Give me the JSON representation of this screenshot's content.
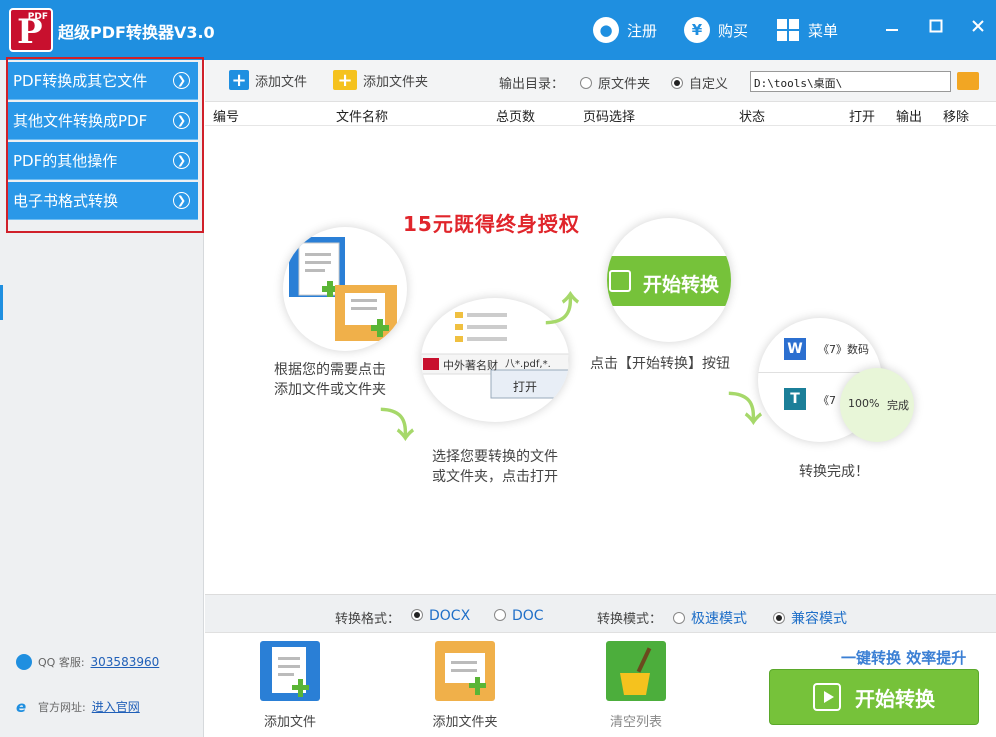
{
  "app": {
    "title": "超级PDF转换器V3.0",
    "logo_tag": "PDF",
    "logo_letter": "P"
  },
  "titlebar": {
    "register": "注册",
    "buy": "购买",
    "menu": "菜单",
    "buy_glyph": "¥"
  },
  "sidebar": {
    "items": [
      {
        "label": "PDF转换成其它文件"
      },
      {
        "label": "其他文件转换成PDF"
      },
      {
        "label": "PDF的其他操作"
      },
      {
        "label": "电子书格式转换"
      }
    ],
    "qq_label": "QQ 客服:",
    "qq_value": "303583960",
    "site_label": "官方网址:",
    "site_link": "进入官网"
  },
  "toolbar": {
    "add_file": "添加文件",
    "add_folder": "添加文件夹",
    "output_dir_label": "输出目录：",
    "opt_original": "原文件夹",
    "opt_custom": "自定义",
    "path_value": "D:\\tools\\桌面\\"
  },
  "table": {
    "columns": [
      "编号",
      "文件名称",
      "总页数",
      "页码选择",
      "状态",
      "打开",
      "输出",
      "移除"
    ]
  },
  "guide": {
    "promo": "15元既得终身授权",
    "step1": [
      "根据您的需要点击",
      "添加文件或文件夹"
    ],
    "step2": [
      "选择您要转换的文件",
      "或文件夹，点击打开"
    ],
    "step3": "点击【开始转换】按钮",
    "step4": "转换完成！",
    "bubble_start": "开始转换",
    "bubble_file": "中外著名财",
    "bubble_filter": "八*.pdf,*.",
    "bubble_open": "打开",
    "bubble_row1": "《7》数码",
    "bubble_row2": "《7",
    "bubble_progress": "100%",
    "bubble_done": "完成"
  },
  "options": {
    "format_label": "转换格式：",
    "format_docx": "DOCX",
    "format_doc": "DOC",
    "mode_label": "转换模式：",
    "mode_fast": "极速模式",
    "mode_compat": "兼容模式"
  },
  "bottom": {
    "add_file": "添加文件",
    "add_folder": "添加文件夹",
    "clear_list": "清空列表",
    "slogan": "一键转换  效率提升",
    "start": "开始转换"
  }
}
